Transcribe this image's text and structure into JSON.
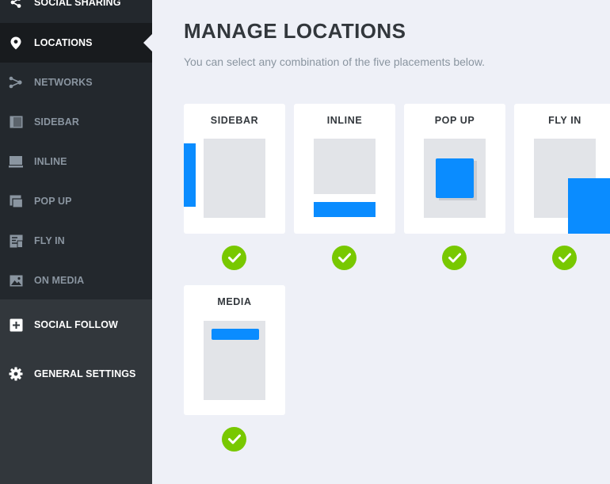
{
  "sidebar": {
    "items": [
      {
        "label": "SOCIAL SHARING",
        "icon": "share-icon"
      },
      {
        "label": "LOCATIONS",
        "icon": "location-pin-icon"
      },
      {
        "label": "NETWORKS",
        "icon": "network-icon"
      },
      {
        "label": "SIDEBAR",
        "icon": "sidebar-layout-icon"
      },
      {
        "label": "INLINE",
        "icon": "inline-layout-icon"
      },
      {
        "label": "POP UP",
        "icon": "popup-layout-icon"
      },
      {
        "label": "FLY IN",
        "icon": "flyin-layout-icon"
      },
      {
        "label": "ON MEDIA",
        "icon": "image-icon"
      },
      {
        "label": "SOCIAL FOLLOW",
        "icon": "plus-square-icon"
      },
      {
        "label": "GENERAL SETTINGS",
        "icon": "gear-icon"
      }
    ],
    "active": "LOCATIONS"
  },
  "main": {
    "title": "MANAGE LOCATIONS",
    "subtitle": "You can select any combination of the five placements below.",
    "locations": [
      {
        "name": "SIDEBAR",
        "selected": true
      },
      {
        "name": "INLINE",
        "selected": true
      },
      {
        "name": "POP UP",
        "selected": true
      },
      {
        "name": "FLY IN",
        "selected": true
      },
      {
        "name": "MEDIA",
        "selected": true
      }
    ]
  },
  "colors": {
    "accent_blue": "#0a8cff",
    "check_green": "#78c800",
    "sidebar_dark": "#23282d",
    "sidebar_bg": "#32373c",
    "main_bg": "#eef0f7"
  }
}
